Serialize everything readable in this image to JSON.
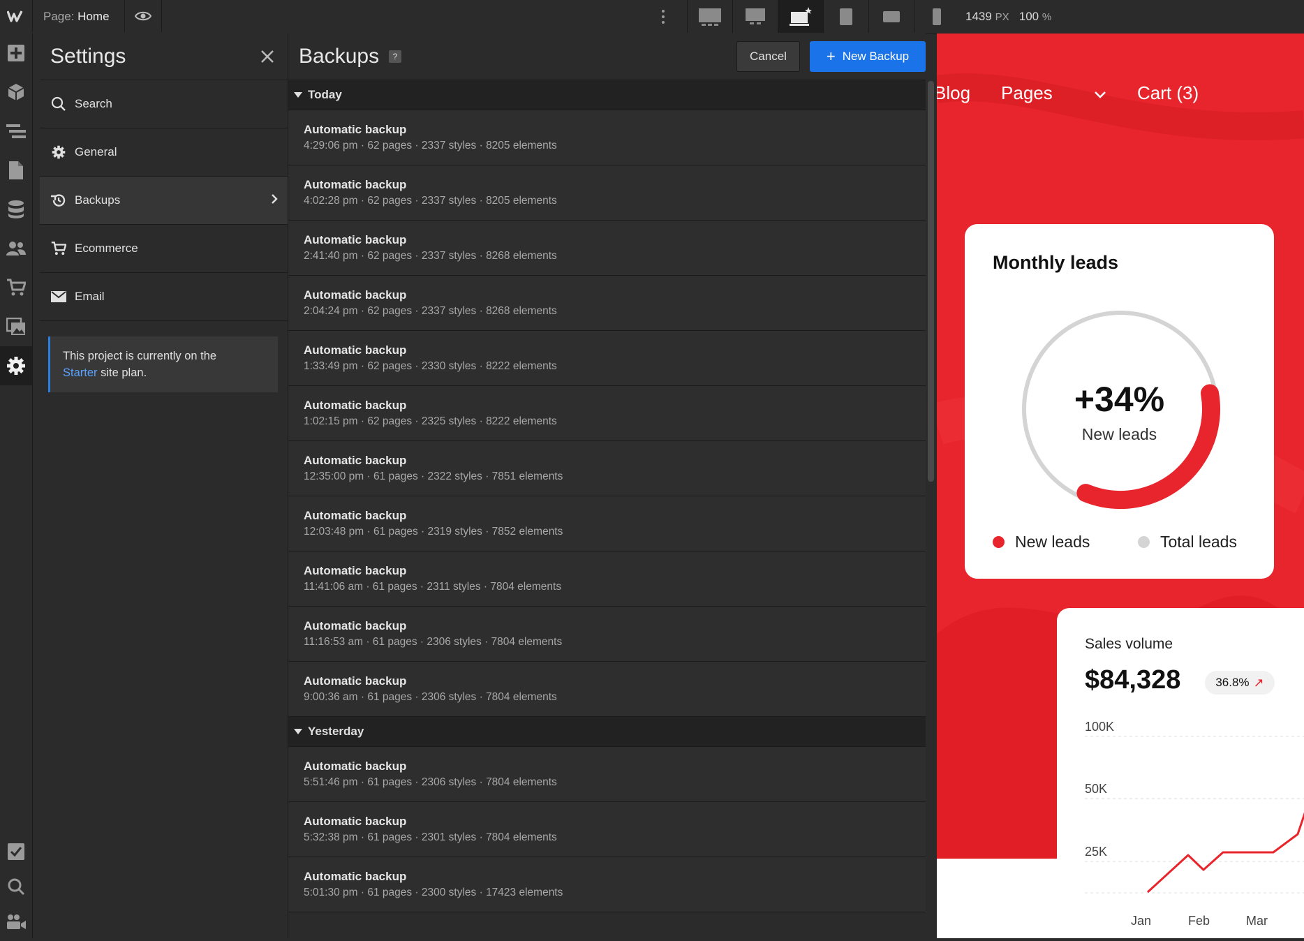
{
  "topbar": {
    "page_prefix": "Page:",
    "page_name": "Home",
    "width_value": "1439",
    "width_unit": "PX",
    "zoom_value": "100",
    "zoom_unit": "%"
  },
  "settings": {
    "title": "Settings",
    "nav": [
      {
        "label": "Search",
        "icon": "search-icon"
      },
      {
        "label": "General",
        "icon": "gear-icon"
      },
      {
        "label": "Backups",
        "icon": "history-icon"
      },
      {
        "label": "Ecommerce",
        "icon": "cart-icon"
      },
      {
        "label": "Email",
        "icon": "mail-icon"
      }
    ],
    "plan_text_1": "This project is currently on the",
    "plan_link": "Starter",
    "plan_text_2": " site plan."
  },
  "backups": {
    "title": "Backups",
    "help": "?",
    "cancel_label": "Cancel",
    "new_label": "New Backup",
    "sections": [
      {
        "label": "Today",
        "rows": [
          {
            "title": "Automatic backup",
            "meta": "4:29:06 pm · 62 pages · 2337 styles · 8205 elements"
          },
          {
            "title": "Automatic backup",
            "meta": "4:02:28 pm · 62 pages · 2337 styles · 8205 elements"
          },
          {
            "title": "Automatic backup",
            "meta": "2:41:40 pm · 62 pages · 2337 styles · 8268 elements"
          },
          {
            "title": "Automatic backup",
            "meta": "2:04:24 pm · 62 pages · 2337 styles · 8268 elements"
          },
          {
            "title": "Automatic backup",
            "meta": "1:33:49 pm · 62 pages · 2330 styles · 8222 elements"
          },
          {
            "title": "Automatic backup",
            "meta": "1:02:15 pm · 62 pages · 2325 styles · 8222 elements"
          },
          {
            "title": "Automatic backup",
            "meta": "12:35:00 pm · 61 pages · 2322 styles · 7851 elements"
          },
          {
            "title": "Automatic backup",
            "meta": "12:03:48 pm · 61 pages · 2319 styles · 7852 elements"
          },
          {
            "title": "Automatic backup",
            "meta": "11:41:06 am · 61 pages · 2311 styles · 7804 elements"
          },
          {
            "title": "Automatic backup",
            "meta": "11:16:53 am · 61 pages · 2306 styles · 7804 elements"
          },
          {
            "title": "Automatic backup",
            "meta": "9:00:36 am · 61 pages · 2306 styles · 7804 elements"
          }
        ]
      },
      {
        "label": "Yesterday",
        "rows": [
          {
            "title": "Automatic backup",
            "meta": "5:51:46 pm · 61 pages · 2306 styles · 7804 elements"
          },
          {
            "title": "Automatic backup",
            "meta": "5:32:38 pm · 61 pages · 2301 styles · 7804 elements"
          },
          {
            "title": "Automatic backup",
            "meta": "5:01:30 pm · 61 pages · 2300 styles · 17423 elements"
          }
        ]
      }
    ]
  },
  "preview": {
    "nav": [
      "Blog",
      "Pages",
      "Cart (3)"
    ],
    "leads": {
      "title": "Monthly leads",
      "value": "+34%",
      "label": "New leads",
      "legend_new": "New leads",
      "legend_total": "Total leads",
      "new_fraction": 0.34
    },
    "sales": {
      "title": "Sales volume",
      "value": "$84,328",
      "change": "36.8%",
      "y_labels": [
        "100K",
        "50K",
        "25K"
      ],
      "x_labels": [
        "Jan",
        "Feb",
        "Mar"
      ]
    }
  },
  "colors": {
    "accent": "#1a73e8",
    "brand_red": "#e8252c",
    "panel": "#2b2b2b"
  }
}
